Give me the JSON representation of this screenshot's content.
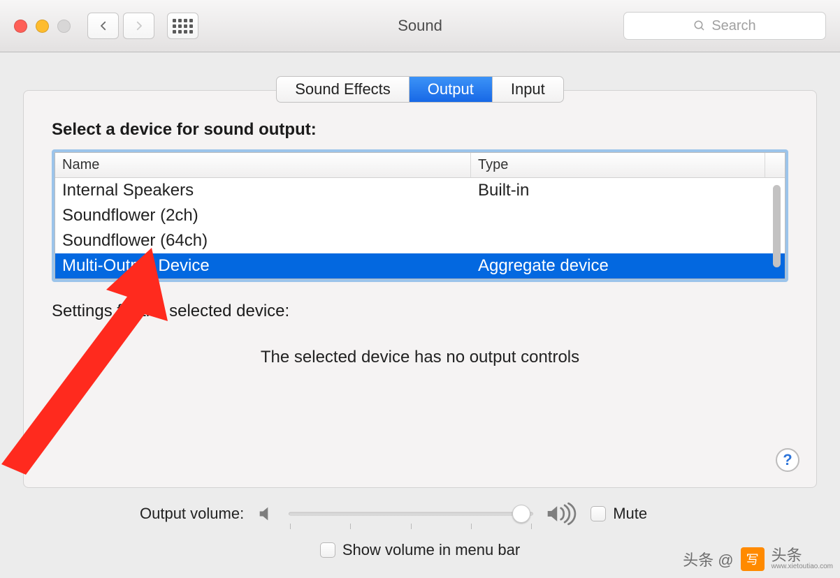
{
  "window": {
    "title": "Sound"
  },
  "toolbar": {
    "search_placeholder": "Search"
  },
  "tabs": {
    "sound_effects": "Sound Effects",
    "output": "Output",
    "input": "Input",
    "active": "output"
  },
  "main": {
    "select_title": "Select a device for sound output:",
    "columns": {
      "name": "Name",
      "type": "Type"
    },
    "devices": [
      {
        "name": "Internal Speakers",
        "type": "Built-in",
        "selected": false
      },
      {
        "name": "Soundflower (2ch)",
        "type": "",
        "selected": false
      },
      {
        "name": "Soundflower (64ch)",
        "type": "",
        "selected": false
      },
      {
        "name": "Multi-Output Device",
        "type": "Aggregate device",
        "selected": true
      }
    ],
    "settings_title": "Settings for the selected device:",
    "no_controls": "The selected device has no output controls",
    "help_label": "?"
  },
  "volume": {
    "label": "Output volume:",
    "value_percent": 95,
    "mute_label": "Mute",
    "mute_checked": false,
    "show_in_menu_label": "Show volume in menu bar",
    "show_in_menu_checked": false
  },
  "watermark": {
    "prefix": "头条 @",
    "logo": "写",
    "brand": "头条",
    "url": "www.xietoutiao.com"
  },
  "colors": {
    "selection": "#0368e0",
    "tab_active_top": "#3c93f7",
    "tab_active_bottom": "#1768e6",
    "arrow": "#ff2a1e"
  }
}
